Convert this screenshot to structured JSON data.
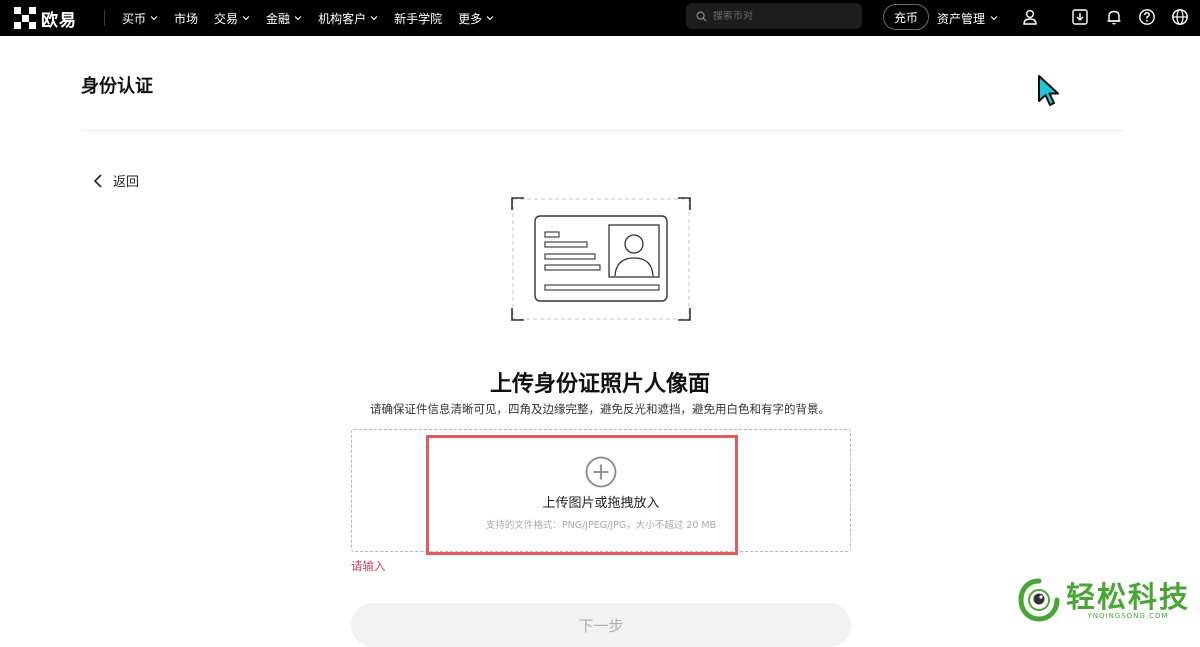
{
  "brand": {
    "name": "欧易"
  },
  "nav": {
    "items": [
      {
        "label": "买币",
        "has_dropdown": true
      },
      {
        "label": "市场",
        "has_dropdown": false
      },
      {
        "label": "交易",
        "has_dropdown": true
      },
      {
        "label": "金融",
        "has_dropdown": true
      },
      {
        "label": "机构客户",
        "has_dropdown": true
      },
      {
        "label": "新手学院",
        "has_dropdown": false
      },
      {
        "label": "更多",
        "has_dropdown": true
      }
    ],
    "search_placeholder": "搜索币对",
    "deposit_label": "充币",
    "asset_label": "资产管理"
  },
  "page": {
    "title": "身份认证",
    "back_label": "返回"
  },
  "upload": {
    "title": "上传身份证照片人像面",
    "description": "请确保证件信息清晰可见，四角及边缘完整，避免反光和遮挡，避免用白色和有字的背景。",
    "drop_label": "上传图片或拖拽放入",
    "drop_hint": "支持的文件格式：PNG/JPEG/JPG，大小不超过 20 MB",
    "error": "请输入",
    "next_label": "下一步"
  },
  "watermark": {
    "main": "轻松科技",
    "sub": "YNQINGSONG.COM"
  },
  "colors": {
    "topbar": "#000000",
    "highlight": "#e15c5c",
    "error": "#d2455a",
    "watermark": "#4aa634",
    "cursor": "#1fc8d8"
  },
  "icons": [
    "search-icon",
    "user-icon",
    "download-icon",
    "bell-icon",
    "help-icon",
    "globe-icon",
    "back-chevron-icon",
    "plus-circle-icon",
    "id-card-icon",
    "mouse-cursor-icon"
  ]
}
